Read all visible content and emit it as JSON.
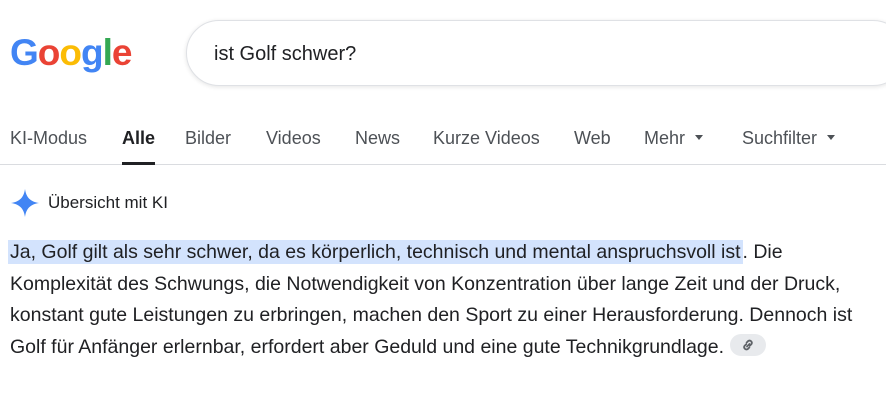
{
  "logo": {
    "letters": [
      "G",
      "o",
      "o",
      "g",
      "l",
      "e"
    ],
    "colors": [
      "#4285f4",
      "#ea4335",
      "#fbbc05",
      "#4285f4",
      "#34a853",
      "#ea4335"
    ]
  },
  "search": {
    "query": "ist Golf schwer?"
  },
  "tabs": [
    {
      "label": "KI-Modus"
    },
    {
      "label": "Alle",
      "active": true
    },
    {
      "label": "Bilder"
    },
    {
      "label": "Videos"
    },
    {
      "label": "News"
    },
    {
      "label": "Kurze Videos"
    },
    {
      "label": "Web"
    },
    {
      "label": "Mehr"
    },
    {
      "label": "Suchfilter"
    }
  ],
  "ai_overview": {
    "title": "Übersicht mit KI",
    "highlighted": "Ja, Golf gilt als sehr schwer, da es körperlich, technisch und mental anspruchsvoll ist",
    "body": ". Die Komplexität des Schwungs, die Notwendigkeit von Konzentration über lange Zeit und der Druck, konstant gute Leistungen zu erbringen, machen den Sport zu einer Herausforderung. Dennoch ist Golf für Anfänger erlernbar, erfordert aber Geduld und eine gute Technikgrundlage.",
    "link_icon": "link-icon",
    "sparkle_color": "#4285f4"
  }
}
